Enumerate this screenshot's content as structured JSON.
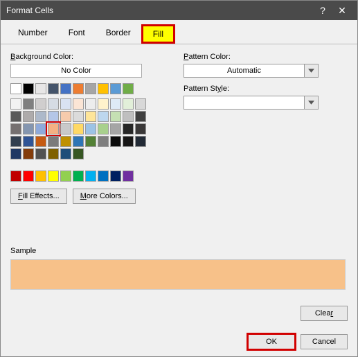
{
  "title": "Format Cells",
  "tabs": [
    "Number",
    "Font",
    "Border",
    "Fill"
  ],
  "activeTab": "Fill",
  "labels": {
    "bgColor": "Background Color:",
    "noColor": "No Color",
    "fillEffects": "Fill Effects...",
    "moreColors": "More Colors...",
    "patternColor": "Pattern Color:",
    "patternStyle": "Pattern Style:",
    "automatic": "Automatic",
    "sample": "Sample",
    "clear": "Clear",
    "ok": "OK",
    "cancel": "Cancel"
  },
  "sampleColor": "#f7c189",
  "selectedSwatch": "#f7c189",
  "themeRow1": [
    "#ffffff",
    "#000000",
    "#e7e6e6",
    "#44546a",
    "#4472c4",
    "#ed7d31",
    "#a5a5a5",
    "#ffc000",
    "#5b9bd5",
    "#70ad47"
  ],
  "themeShades": [
    [
      "#f2f2f2",
      "#808080",
      "#d0cece",
      "#d6dce4",
      "#d9e2f3",
      "#fbe5d5",
      "#ededed",
      "#fff2cc",
      "#deebf6",
      "#e2efd9"
    ],
    [
      "#d8d8d8",
      "#595959",
      "#aeabab",
      "#adb9ca",
      "#b4c6e7",
      "#f7cbac",
      "#dbdbdb",
      "#fee599",
      "#bdd7ee",
      "#c5e0b3"
    ],
    [
      "#bfbfbf",
      "#3f3f3f",
      "#757070",
      "#8496b0",
      "#8eaadb",
      "#f4b183",
      "#c9c9c9",
      "#ffd965",
      "#9cc3e5",
      "#a8d08d"
    ],
    [
      "#a5a5a5",
      "#262626",
      "#3a3838",
      "#323f4f",
      "#2f5496",
      "#c55a11",
      "#7b7b7b",
      "#bf9000",
      "#2e75b5",
      "#538135"
    ],
    [
      "#7f7f7f",
      "#0c0c0c",
      "#171616",
      "#222a35",
      "#1f3864",
      "#833c0b",
      "#525252",
      "#7f6000",
      "#1e4e79",
      "#375623"
    ]
  ],
  "standardColors": [
    "#c00000",
    "#ff0000",
    "#ffc000",
    "#ffff00",
    "#92d050",
    "#00b050",
    "#00b0f0",
    "#0070c0",
    "#002060",
    "#7030a0"
  ]
}
